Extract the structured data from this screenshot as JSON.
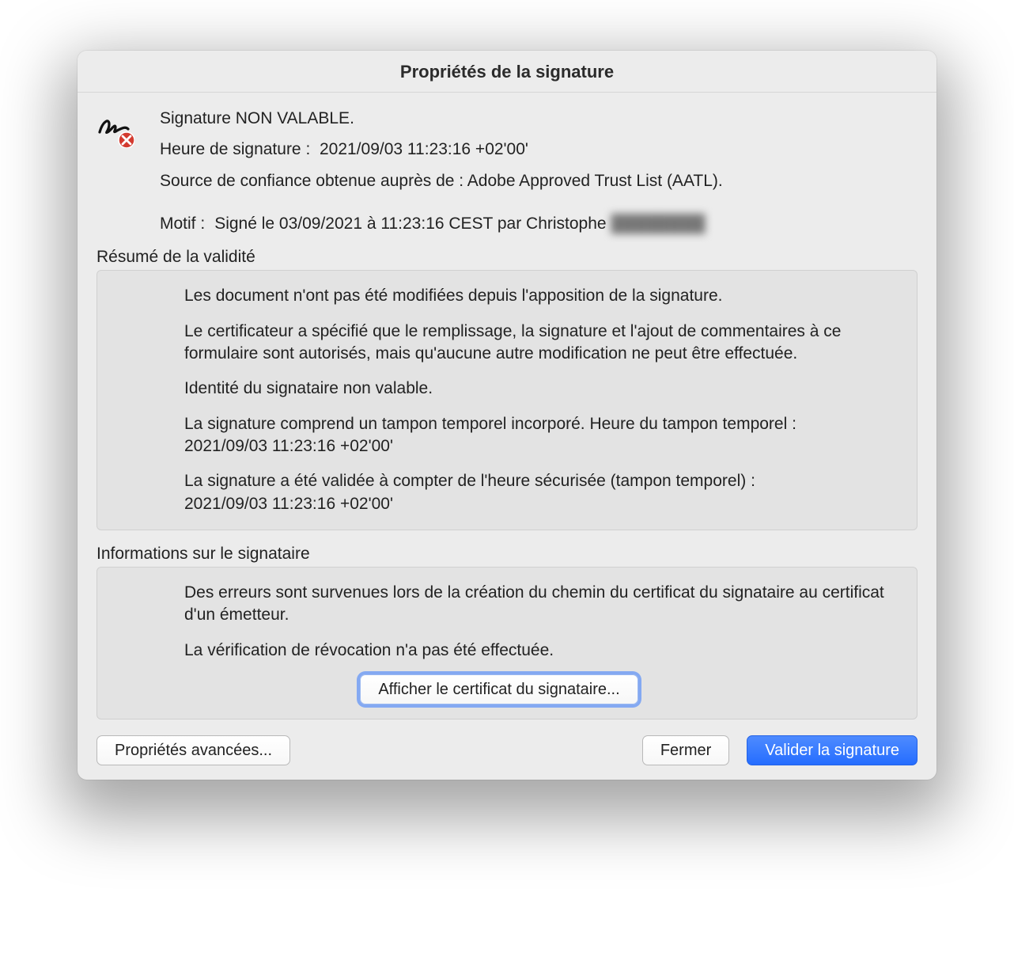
{
  "title": "Propriétés de la signature",
  "status_line": "Signature NON VALABLE.",
  "time_label": "Heure de signature :",
  "time_value": "2021/09/03 11:23:16 +02'00'",
  "trust_source": "Source de confiance obtenue auprès de : Adobe Approved Trust List (AATL).",
  "motif_label": "Motif :",
  "motif_value": "Signé le 03/09/2021 à 11:23:16 CEST par Christophe",
  "motif_redacted": "████████",
  "validity": {
    "heading": "Résumé de la validité",
    "p1": "Les document n'ont pas été modifiées depuis l'apposition de la signature.",
    "p2": "Le certificateur a spécifié que le remplissage, la signature et l'ajout de commentaires à ce formulaire sont autorisés, mais qu'aucune autre modification ne peut être effectuée.",
    "p3": "Identité du signataire non valable.",
    "p4": "La signature comprend un tampon temporel incorporé. Heure du tampon temporel :\n2021/09/03 11:23:16 +02'00'",
    "p5": "La signature a été validée à compter de l'heure sécurisée (tampon temporel) :\n2021/09/03 11:23:16 +02'00'"
  },
  "signer": {
    "heading": "Informations sur le signataire",
    "p1": "Des erreurs sont survenues lors de la création du chemin du certificat du signataire au certificat d'un émetteur.",
    "p2": "La vérification de révocation n'a pas été effectuée.",
    "show_cert_button": "Afficher le certificat du signataire..."
  },
  "buttons": {
    "advanced": "Propriétés avancées...",
    "close": "Fermer",
    "validate": "Valider la signature"
  }
}
